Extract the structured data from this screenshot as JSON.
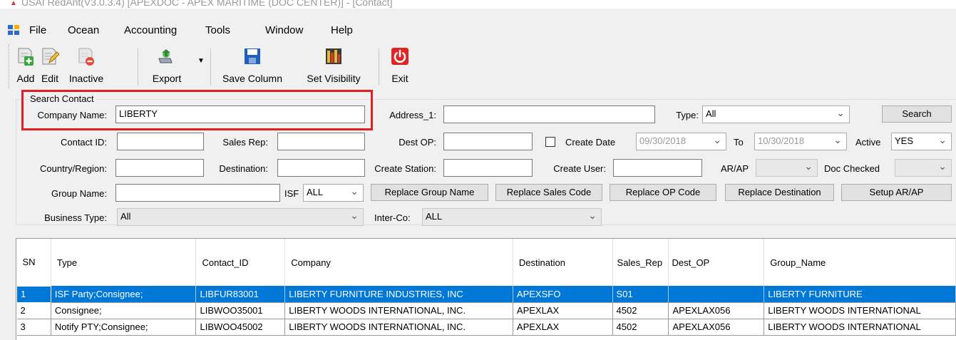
{
  "window": {
    "title": "USAI RedAnt(V3.0.3.4) [APEXDOC - APEX MARITIME (DOC CENTER)] - [Contact]"
  },
  "menu": [
    "File",
    "Ocean",
    "Accounting",
    "Tools",
    "Window",
    "Help"
  ],
  "toolbar": {
    "add": "Add",
    "edit": "Edit",
    "inactive": "Inactive",
    "export": "Export",
    "save_column": "Save Column",
    "set_visibility": "Set Visibility",
    "exit": "Exit"
  },
  "search": {
    "group_title": "Search Contact",
    "company_name_label": "Company Name:",
    "company_name_value": "LIBERTY",
    "address1_label": "Address_1:",
    "address1_value": "",
    "type_label": "Type:",
    "type_value": "All",
    "search_button": "Search",
    "contact_id_label": "Contact ID:",
    "sales_rep_label": "Sales Rep:",
    "dest_op_label": "Dest OP:",
    "create_date_label": "Create Date",
    "create_date_from": "09/30/2018",
    "to_label": "To",
    "create_date_to": "10/30/2018",
    "active_label": "Active",
    "active_value": "YES",
    "country_label": "Country/Region:",
    "destination_label": "Destination:",
    "create_station_label": "Create Station:",
    "create_user_label": "Create User:",
    "arap_label": "AR/AP",
    "doc_checked_label": "Doc Checked",
    "group_name_label": "Group Name:",
    "isf_label": "ISF",
    "isf_value": "ALL",
    "replace_group_name": "Replace Group Name",
    "replace_sales_code": "Replace Sales Code",
    "replace_op_code": "Replace OP Code",
    "replace_destination": "Replace Destination",
    "setup_arap": "Setup AR/AP",
    "business_type_label": "Business Type:",
    "business_type_value": "All",
    "interco_label": "Inter-Co:",
    "interco_value": "ALL"
  },
  "grid": {
    "columns": [
      "SN",
      "Type",
      "Contact_ID",
      "Company",
      "Destination",
      "Sales_Rep",
      "Dest_OP",
      "Group_Name"
    ],
    "rows": [
      [
        "1",
        "ISF Party;Consignee;",
        "LIBFUR83001",
        "LIBERTY FURNITURE INDUSTRIES, INC",
        "APEXSFO",
        "S01",
        "",
        "LIBERTY FURNITURE"
      ],
      [
        "2",
        "Consignee;",
        "LIBWOO35001",
        "LIBERTY WOODS INTERNATIONAL, INC.",
        "APEXLAX",
        "4502",
        "APEXLAX056",
        "LIBERTY WOODS INTERNATIONAL"
      ],
      [
        "3",
        "Notify PTY;Consignee;",
        "LIBWOO45002",
        "LIBERTY WOODS INTERNATIONAL, INC.",
        "APEXLAX",
        "4502",
        "APEXLAX056",
        "LIBERTY WOODS INTERNATIONAL"
      ]
    ]
  },
  "colors": {
    "selection": "#0078d7",
    "highlight_box": "#e02020"
  }
}
